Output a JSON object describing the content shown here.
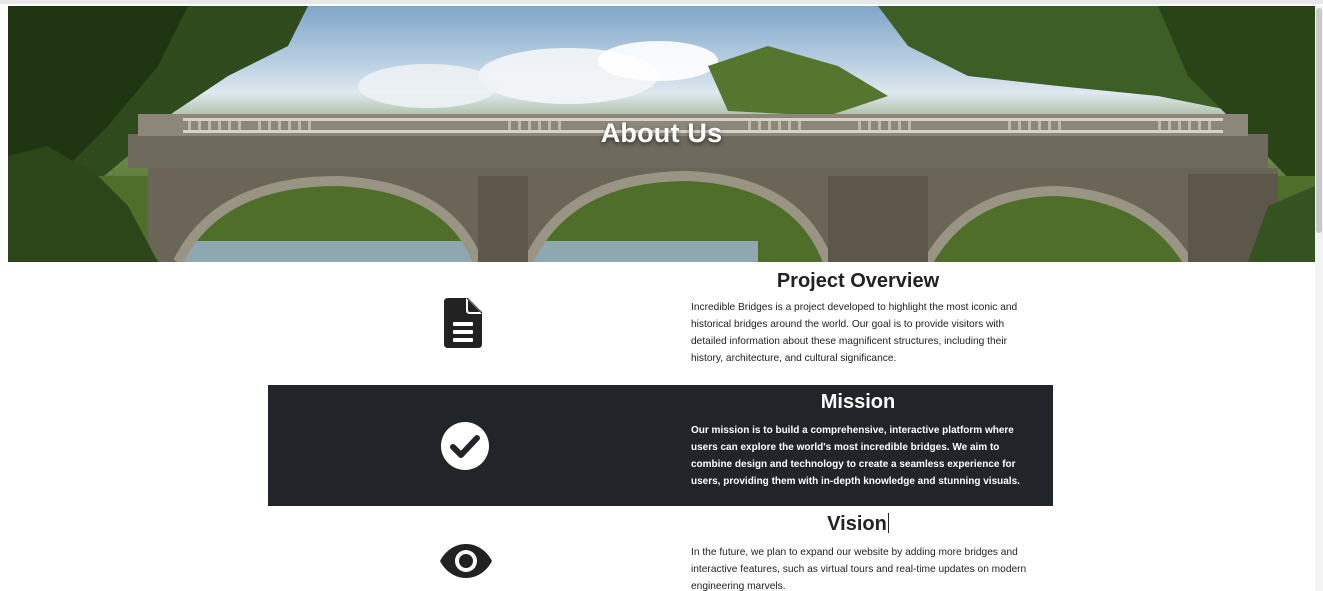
{
  "hero": {
    "title": "About Us"
  },
  "sections": [
    {
      "id": "overview",
      "heading": "Project Overview",
      "icon": "document-icon",
      "text": "Incredible Bridges is a project developed to highlight the most iconic and historical bridges around the world. Our goal is to provide visitors with detailed information about these magnificent structures, including their history, architecture, and cultural significance.",
      "theme": "light"
    },
    {
      "id": "mission",
      "heading": "Mission",
      "icon": "check-circle-icon",
      "text": "Our mission is to build a comprehensive, interactive platform where users can explore the world's most incredible bridges. We aim to combine design and technology to create a seamless experience for users, providing them with in-depth knowledge and stunning visuals.",
      "theme": "dark"
    },
    {
      "id": "vision",
      "heading": "Vision",
      "icon": "eye-icon",
      "text": "In the future, we plan to expand our website by adding more bridges and interactive features, such as virtual tours and real-time updates on modern engineering marvels.",
      "theme": "light"
    }
  ],
  "colors": {
    "dark_band": "#212529",
    "text": "#222222",
    "hero_title": "#ffffff"
  }
}
